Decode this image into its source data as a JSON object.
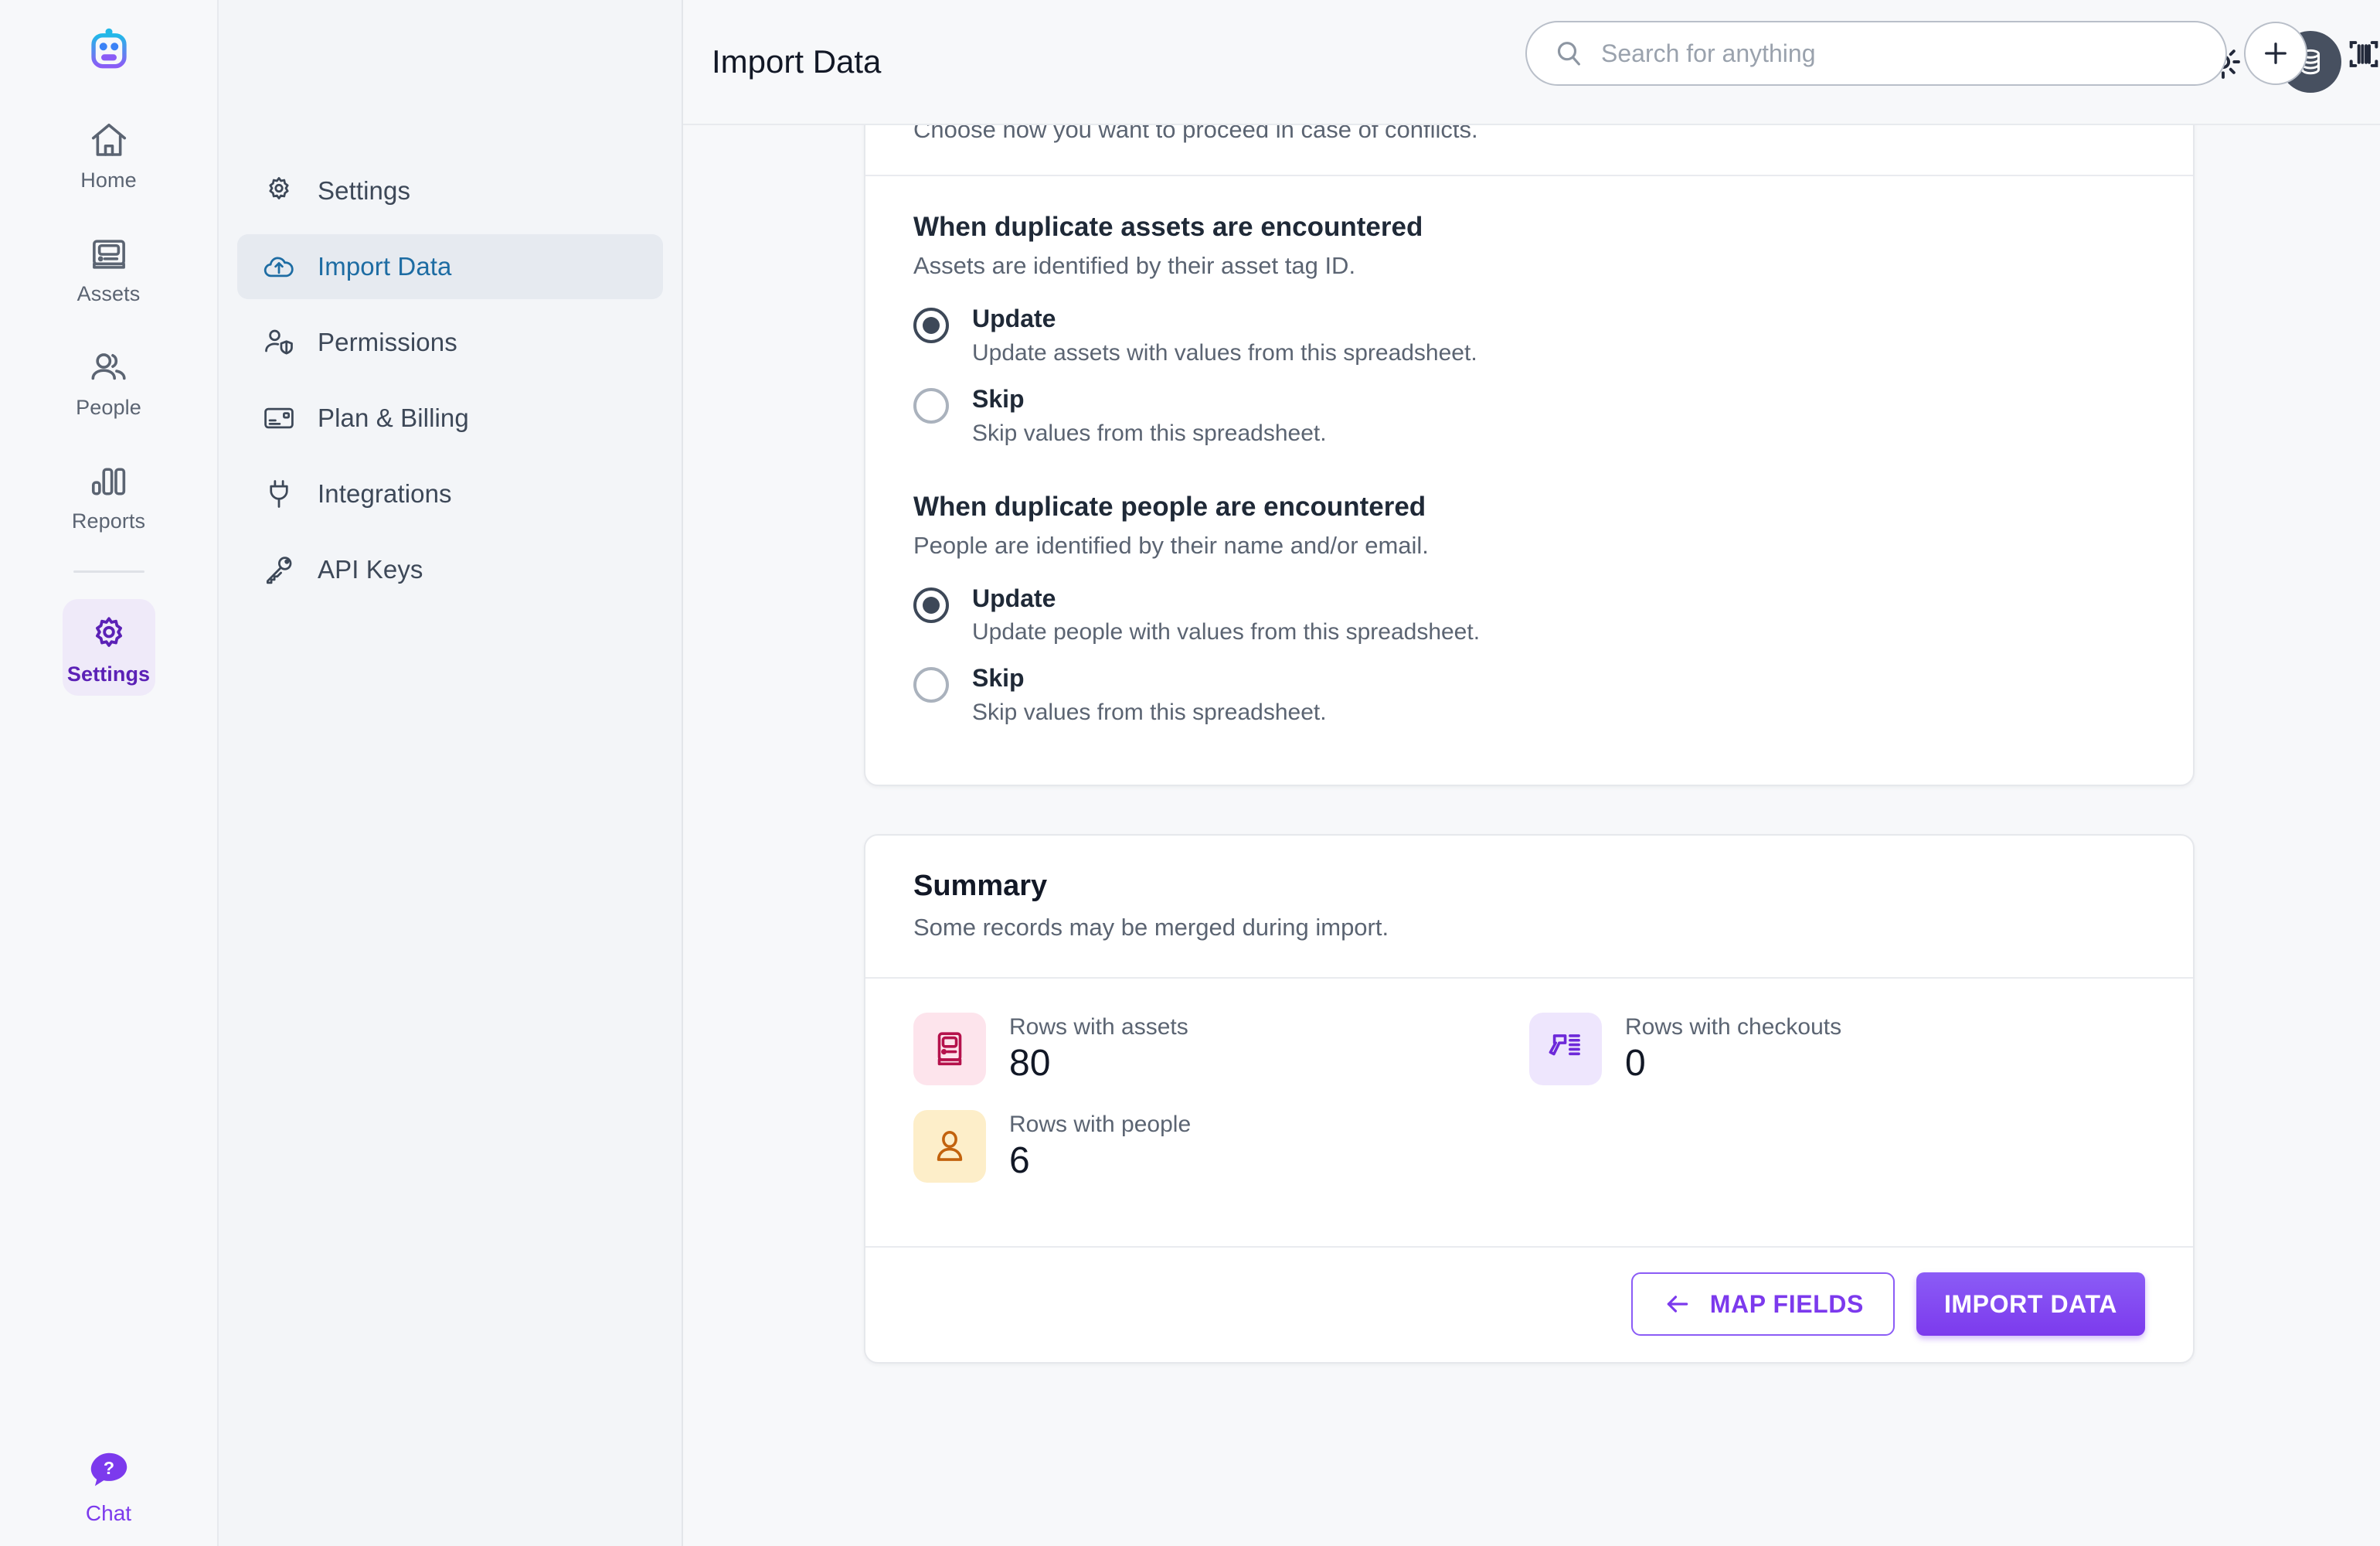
{
  "app": {
    "logo_icon": "robot-logo-icon"
  },
  "rail": {
    "items": [
      {
        "label": "Home",
        "icon": "home-icon",
        "active": false
      },
      {
        "label": "Assets",
        "icon": "assets-icon",
        "active": false
      },
      {
        "label": "People",
        "icon": "people-icon",
        "active": false
      },
      {
        "label": "Reports",
        "icon": "reports-icon",
        "active": false
      },
      {
        "label": "Settings",
        "icon": "gear-icon",
        "active": true
      }
    ],
    "chat": {
      "label": "Chat",
      "icon": "chat-help-icon"
    }
  },
  "subnav": {
    "items": [
      {
        "label": "Settings",
        "icon": "gear-icon",
        "active": false
      },
      {
        "label": "Import Data",
        "icon": "cloud-upload-icon",
        "active": true
      },
      {
        "label": "Permissions",
        "icon": "user-shield-icon",
        "active": false
      },
      {
        "label": "Plan & Billing",
        "icon": "credit-card-icon",
        "active": false
      },
      {
        "label": "Integrations",
        "icon": "plug-icon",
        "active": false
      },
      {
        "label": "API Keys",
        "icon": "key-icon",
        "active": false
      }
    ]
  },
  "header": {
    "title": "Import Data",
    "search_placeholder": "Search for anything",
    "search_value": "",
    "add_icon": "plus-icon",
    "scan_icon": "barcode-scan-icon",
    "theme_icon": "sun-icon",
    "avatar_icon": "database-avatar-icon"
  },
  "conflicts": {
    "subtitle": "Choose how you want to proceed in case of conflicts.",
    "groups": [
      {
        "title": "When duplicate assets are encountered",
        "description": "Assets are identified by their asset tag ID.",
        "options": [
          {
            "label": "Update",
            "description": "Update assets with values from this spreadsheet.",
            "selected": true
          },
          {
            "label": "Skip",
            "description": "Skip values from this spreadsheet.",
            "selected": false
          }
        ]
      },
      {
        "title": "When duplicate people are encountered",
        "description": "People are identified by their name and/or email.",
        "options": [
          {
            "label": "Update",
            "description": "Update people with values from this spreadsheet.",
            "selected": true
          },
          {
            "label": "Skip",
            "description": "Skip values from this spreadsheet.",
            "selected": false
          }
        ]
      }
    ]
  },
  "summary": {
    "title": "Summary",
    "subtitle": "Some records may be merged during import.",
    "stats": [
      {
        "label": "Rows with assets",
        "value": "80",
        "icon": "asset-device-icon",
        "bg": "#fde4ec",
        "fg": "#b5124c"
      },
      {
        "label": "Rows with checkouts",
        "value": "0",
        "icon": "barcode-gun-icon",
        "bg": "#eee6fd",
        "fg": "#6d28d9"
      },
      {
        "label": "Rows with people",
        "value": "6",
        "icon": "person-icon",
        "bg": "#fdeec9",
        "fg": "#c2620d"
      }
    ],
    "actions": {
      "back_label": "MAP FIELDS",
      "back_icon": "arrow-left-icon",
      "primary_label": "IMPORT DATA"
    }
  },
  "colors": {
    "accent_purple": "#7c3aed",
    "link_blue": "#1d6ca3",
    "page_bg": "#f7f8fa"
  }
}
